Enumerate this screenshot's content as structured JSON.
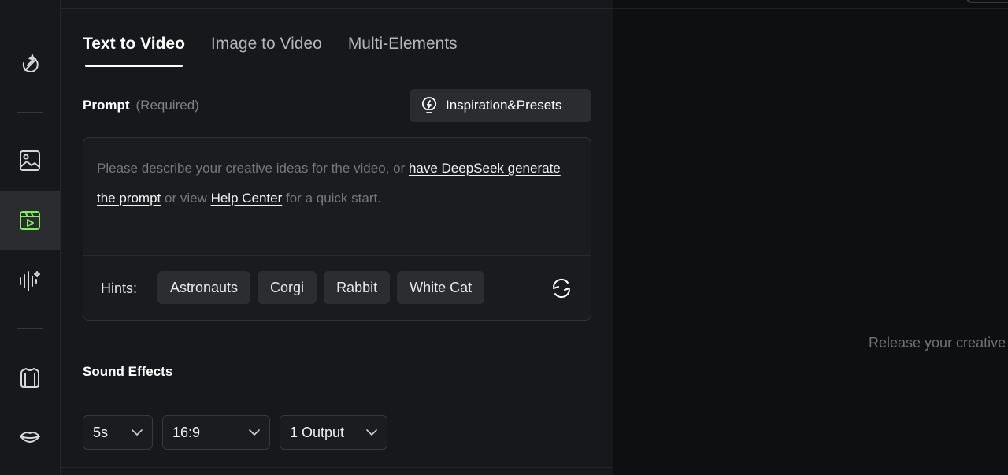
{
  "sidebar": {
    "items": [
      {
        "icon": "magic-wand-icon"
      },
      {
        "icon": "image-icon"
      },
      {
        "icon": "video-icon",
        "active": true
      },
      {
        "icon": "audio-wave-icon"
      },
      {
        "icon": "shirt-icon"
      },
      {
        "icon": "lips-icon"
      }
    ]
  },
  "tabs": [
    {
      "label": "Text to Video",
      "active": true
    },
    {
      "label": "Image to Video"
    },
    {
      "label": "Multi-Elements"
    }
  ],
  "prompt": {
    "label": "Prompt",
    "required": "(Required)",
    "inspiration_label": "Inspiration&Presets",
    "text_part1": "Please describe your creative ideas for the video, or ",
    "link1": "have DeepSeek generate the prompt",
    "text_part2": " or view ",
    "link2": "Help Center",
    "text_part3": " for a quick start."
  },
  "hints": {
    "label": "Hints:",
    "chips": [
      "Astronauts",
      "Corgi",
      "Rabbit",
      "White Cat"
    ]
  },
  "sound_effects": {
    "label": "Sound Effects"
  },
  "settings": {
    "duration": "5s",
    "aspect_ratio": "16:9",
    "outputs": "1 Output"
  },
  "preview": {
    "placeholder": "Release your creative"
  },
  "colors": {
    "accent": "#7cf35a",
    "panel_bg": "#17181b",
    "page_bg": "#0e0f11"
  }
}
